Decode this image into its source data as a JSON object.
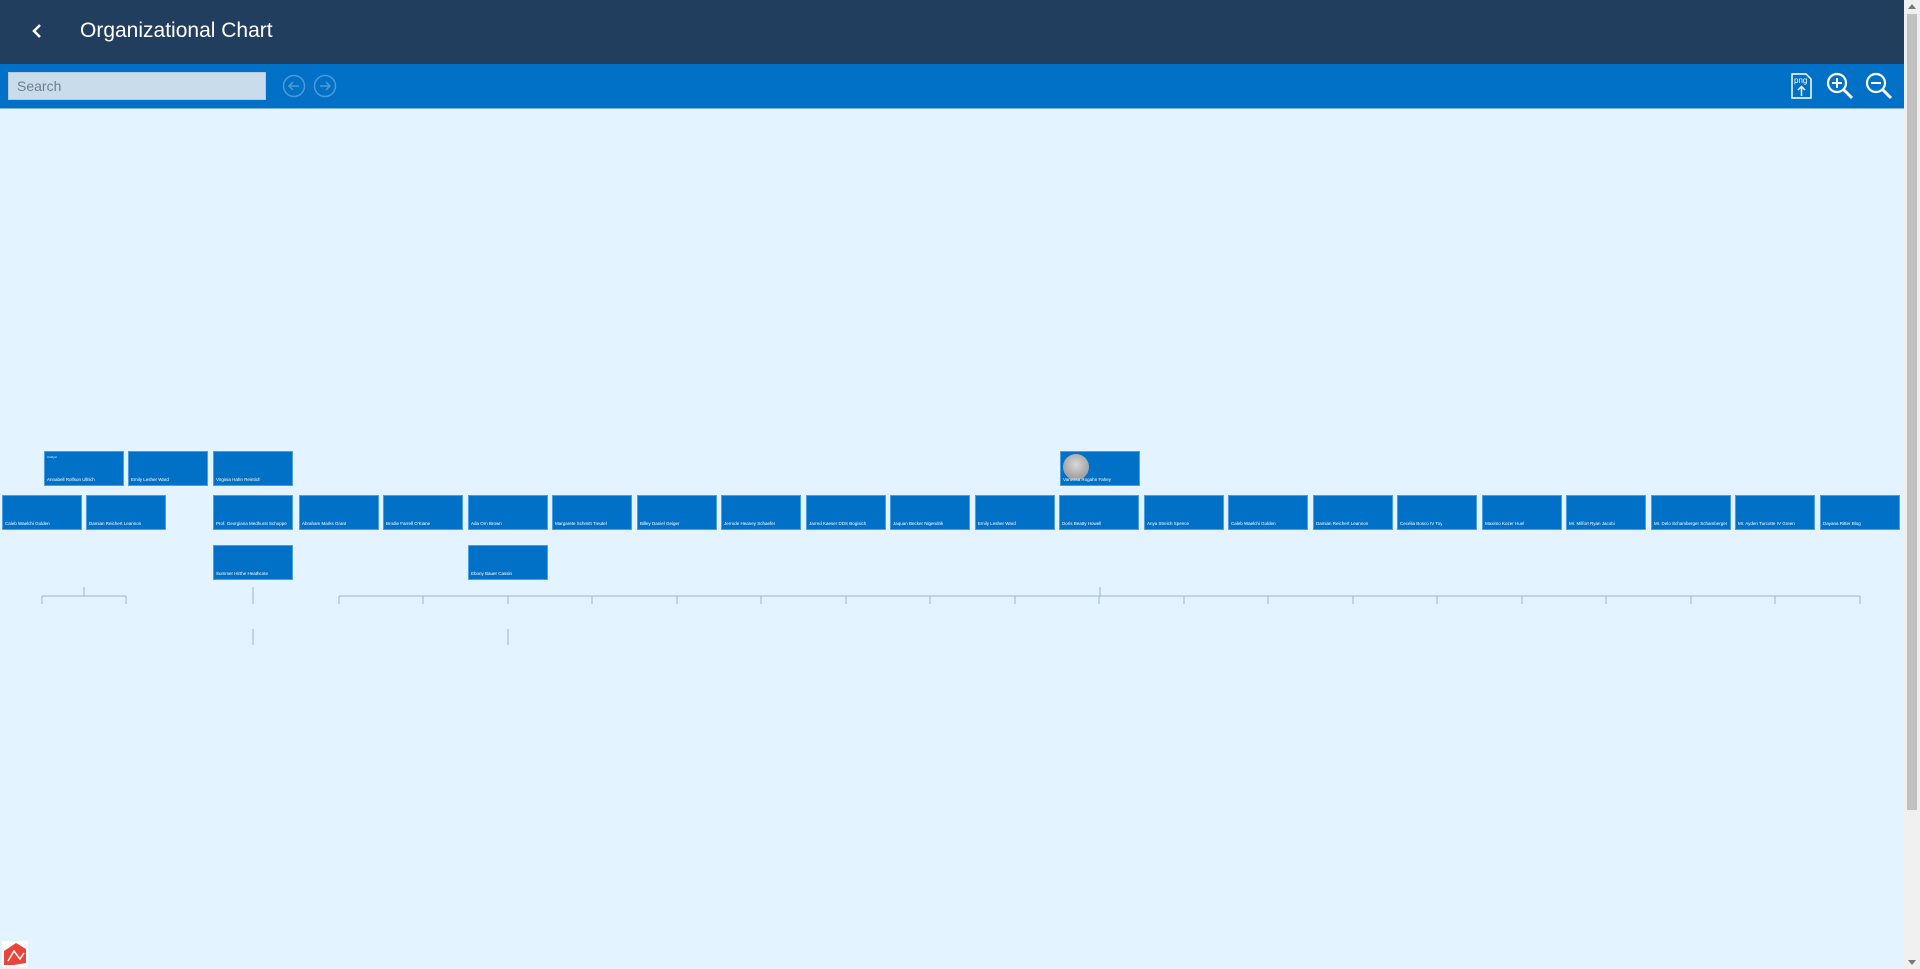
{
  "header": {
    "title": "Organizational Chart"
  },
  "toolbar": {
    "search_placeholder": "Search",
    "export_label": "png"
  },
  "nodes": {
    "vanessa": "Vanessa Rogahn Fahey",
    "n1": "Annabell Rolfson Ullrich",
    "n1_title": "Analyst",
    "n2": "Emily Lesher Ward",
    "n3": "Virginia Hahn Reintich",
    "n4": "Caleb Waelchi Golden",
    "n5": "Damian Reichert Leannon",
    "n6": "Prof. Georgiana Medhurst Schuppe",
    "n7": "Abraham Marks Grant",
    "n8": "Brodie Farrell O'Kiane",
    "n9": "Ada Orn Brown",
    "n10": "Margarete Schmitt Treutel",
    "n11": "Billey Daniel Geiger",
    "n12": "Jerrode Heaney Schaefer",
    "n13": "Jarred Kaeser DDS Bogisich",
    "n14": "Jaquan Becker Nigendrik",
    "n15": "Emily Lesher Ward",
    "n16": "Doris Beatty Howell",
    "n17": "Anya Streich Spence",
    "n18": "Caleb Waelchi Golden",
    "n19": "Damian Reichert Leannon",
    "n20": "Cecelia Bosco IV Toy",
    "n21": "Maximo Kozer Huel",
    "n22": "Mr. Milfort Ryan Jacobi",
    "n23": "Mr. Delo Schamberger Schamberger",
    "n24": "Mr. Ayden Turcotte IV Green",
    "n25": "Dayana Ritter Blog",
    "n26": "Summer Hirthe Heathcote",
    "n27": "Ebony Bauer Cassin"
  }
}
